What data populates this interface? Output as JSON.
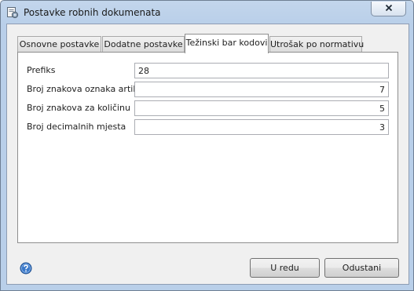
{
  "window": {
    "title": "Postavke robnih dokumenata",
    "icon": "settings-document-icon",
    "close_icon": "close-icon"
  },
  "tabs": [
    {
      "label": "Osnovne postavke",
      "active": false
    },
    {
      "label": "Dodatne postavke",
      "active": false
    },
    {
      "label": "Težinski bar kodovi",
      "active": true
    },
    {
      "label": "Utrošak po normativu",
      "active": false
    }
  ],
  "fields": [
    {
      "label": "Prefiks",
      "value": "28",
      "align": "left"
    },
    {
      "label": "Broj znakova oznaka artikla",
      "value": "7",
      "align": "right"
    },
    {
      "label": "Broj znakova za količinu",
      "value": "5",
      "align": "right"
    },
    {
      "label": "Broj decimalnih mjesta",
      "value": "3",
      "align": "right"
    }
  ],
  "footer": {
    "help_icon": "help-icon",
    "ok_label": "U redu",
    "cancel_label": "Odustani"
  },
  "colors": {
    "frame": "#b9cfe9",
    "client": "#f0f0f0",
    "help": "#3a78c9"
  }
}
